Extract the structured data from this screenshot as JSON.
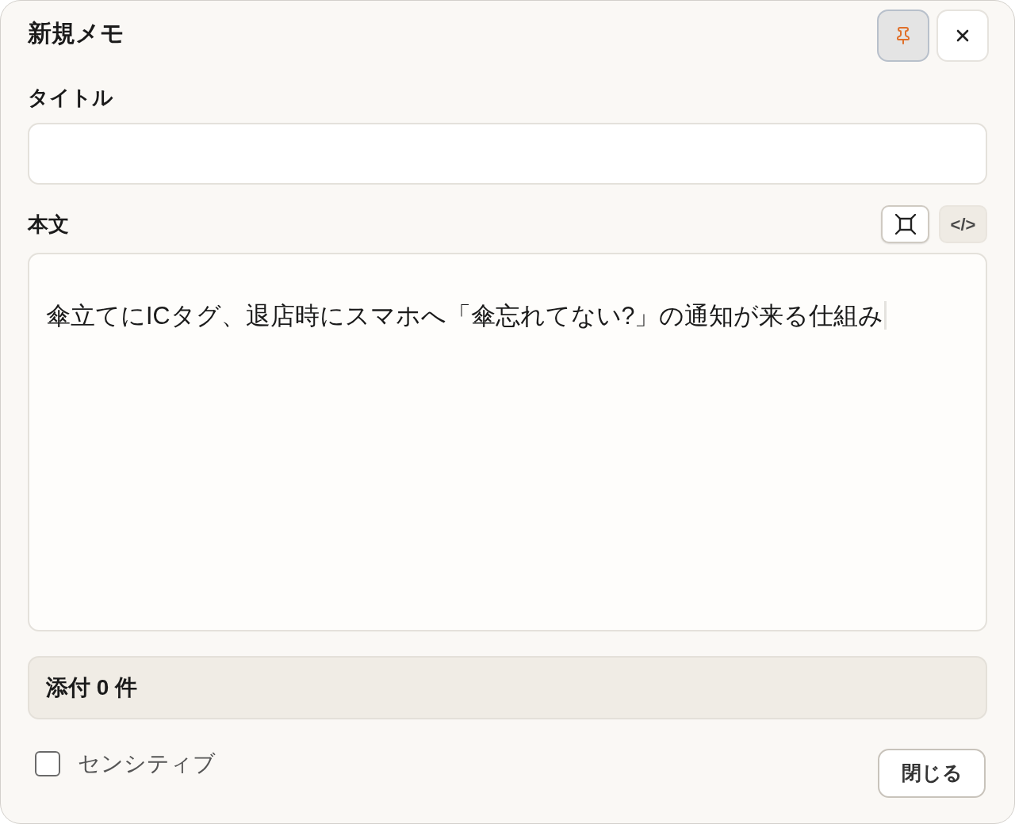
{
  "dialog": {
    "title": "新規メモ",
    "pin": {
      "on": true
    }
  },
  "title_field": {
    "label": "タイトル"
  },
  "body_field": {
    "label": "本文",
    "value": "傘立てにICタグ、退店時にスマホへ「傘忘れてない?」の通知が来る仕組み",
    "toolbar": [
      {
        "kind": "expand",
        "selected": true
      },
      {
        "kind": "code",
        "label": "</>",
        "selected": false
      }
    ]
  },
  "attachments": {
    "text": "添付 0 件"
  },
  "sensitive": {
    "label": "センシティブ",
    "checked": false
  },
  "footer": {
    "close_button": "閉じる"
  }
}
